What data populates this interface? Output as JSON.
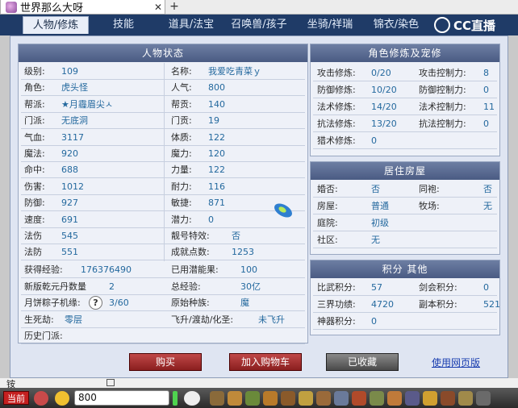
{
  "browser": {
    "tab_title": "世界那么大呀",
    "close_glyph": "✕",
    "newtab_glyph": "+"
  },
  "tabs": [
    "人物/修炼",
    "技能",
    "道具/法宝",
    "召唤兽/孩子",
    "坐骑/祥瑞",
    "锦衣/染色"
  ],
  "logo": {
    "text": "CC直播"
  },
  "status": {
    "title": "人物状态",
    "left": [
      {
        "label": "级别:",
        "value": "109"
      },
      {
        "label": "角色:",
        "value": "虎头怪"
      },
      {
        "label": "帮派:",
        "value": "★月霾眉尖ㅅ"
      },
      {
        "label": "门派:",
        "value": "无底洞"
      },
      {
        "label": "气血:",
        "value": "3117"
      },
      {
        "label": "魔法:",
        "value": "920"
      },
      {
        "label": "命中:",
        "value": "688"
      },
      {
        "label": "伤害:",
        "value": "1012"
      },
      {
        "label": "防御:",
        "value": "927"
      },
      {
        "label": "速度:",
        "value": "691"
      },
      {
        "label": "法伤",
        "value": "545"
      },
      {
        "label": "法防",
        "value": "551"
      }
    ],
    "right": [
      {
        "label": "名称:",
        "value": "我爱吃青菜ｙ"
      },
      {
        "label": "人气:",
        "value": "800"
      },
      {
        "label": "帮贡:",
        "value": "140"
      },
      {
        "label": "门贡:",
        "value": "19"
      },
      {
        "label": "体质:",
        "value": "122"
      },
      {
        "label": "魔力:",
        "value": "120"
      },
      {
        "label": "力量:",
        "value": "122"
      },
      {
        "label": "耐力:",
        "value": "116"
      },
      {
        "label": "敏捷:",
        "value": "871"
      },
      {
        "label": "潜力:",
        "value": "0"
      },
      {
        "label": "靓号特效:",
        "value": "否"
      },
      {
        "label": "成就点数:",
        "value": "1253"
      }
    ],
    "wide": [
      {
        "l1": "获得经验:",
        "v1": "176376490",
        "l2": "已用潜能果:",
        "v2": "100"
      },
      {
        "l1": "新版乾元丹数量",
        "v1": "2",
        "l2": "总经验:",
        "v2": "30亿"
      },
      {
        "l1": "月饼粽子机缘:",
        "v1": "3/60",
        "l2": "原始种族:",
        "v2": "魔"
      },
      {
        "l1": "生死劫:",
        "v1": "零层",
        "l2": "飞升/渡劫/化圣:",
        "v2": "未飞升"
      },
      {
        "l1": "历史门派:",
        "v1": "",
        "l2": "",
        "v2": ""
      }
    ],
    "help_glyph": "?"
  },
  "cultivation": {
    "title": "角色修炼及宠修",
    "rows": [
      {
        "l1": "攻击修炼:",
        "v1": "0/20",
        "l2": "攻击控制力:",
        "v2": "8"
      },
      {
        "l1": "防御修炼:",
        "v1": "10/20",
        "l2": "防御控制力:",
        "v2": "0"
      },
      {
        "l1": "法术修炼:",
        "v1": "14/20",
        "l2": "法术控制力:",
        "v2": "11"
      },
      {
        "l1": "抗法修炼:",
        "v1": "13/20",
        "l2": "抗法控制力:",
        "v2": "0"
      },
      {
        "l1": "猎术修炼:",
        "v1": "0",
        "l2": "",
        "v2": ""
      }
    ]
  },
  "housing": {
    "title": "居住房屋",
    "rows": [
      {
        "l1": "婚否:",
        "v1": "否",
        "l2": "同袍:",
        "v2": "否"
      },
      {
        "l1": "房屋:",
        "v1": "普通",
        "l2": "牧场:",
        "v2": "无"
      },
      {
        "l1": "庭院:",
        "v1": "初级",
        "l2": "",
        "v2": ""
      },
      {
        "l1": "社区:",
        "v1": "无",
        "l2": "",
        "v2": ""
      }
    ]
  },
  "points": {
    "title": "积分 其他",
    "rows": [
      {
        "l1": "比武积分:",
        "v1": "57",
        "l2": "剑会积分:",
        "v2": "0"
      },
      {
        "l1": "三界功绩:",
        "v1": "4720",
        "l2": "副本积分:",
        "v2": "521"
      },
      {
        "l1": "神器积分:",
        "v1": "0",
        "l2": "",
        "v2": ""
      }
    ]
  },
  "buttons": {
    "buy": "购买",
    "cart": "加入购物车",
    "collected": "已收藏",
    "web": "使用网页版"
  },
  "bottom_strip": {
    "text": "铵"
  },
  "taskbar": {
    "current": "当前",
    "chat_value": "800"
  }
}
